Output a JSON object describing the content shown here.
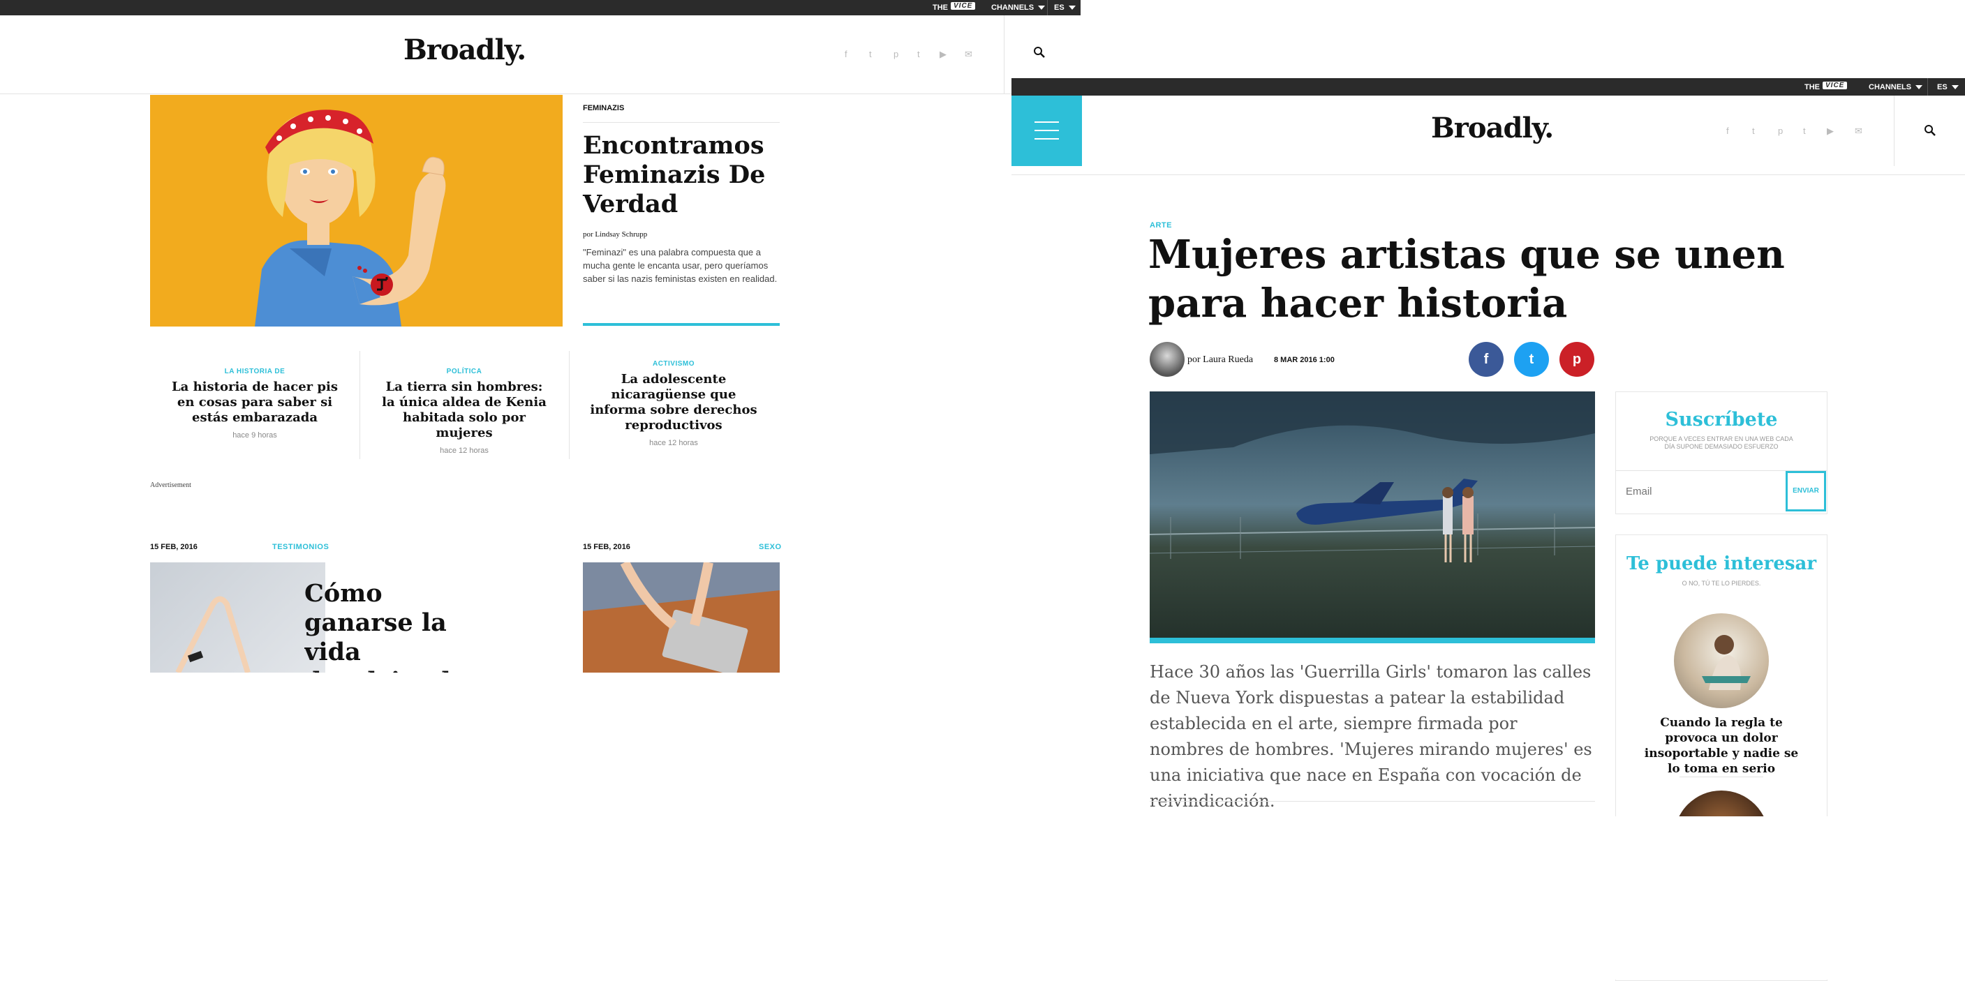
{
  "left": {
    "topbar": {
      "the": "THE",
      "vice": "VICE",
      "channels": "CHANNELS",
      "lang": "ES"
    },
    "brand": "Broadly.",
    "social_icons": [
      "facebook-icon",
      "twitter-icon",
      "pinterest-icon",
      "tumblr-icon",
      "youtube-icon",
      "email-icon"
    ],
    "featured": {
      "category": "FEMINAZIS",
      "title": "Encontramos Feminazis De Verdad",
      "byline": "por Lindsay Schrupp",
      "excerpt": "\"Feminazi\" es una palabra compuesta que a mucha gente le encanta usar, pero queríamos saber si las nazis feministas existen en realidad."
    },
    "cards": [
      {
        "category": "LA HISTORIA DE",
        "title": "La historia de hacer pis en cosas para saber si estás embarazada",
        "time": "hace 9 horas"
      },
      {
        "category": "POLÍTICA",
        "title": "La tierra sin hombres: la única aldea de Kenia habitada solo por mujeres",
        "time": "hace 12 horas"
      },
      {
        "category": "ACTIVISMO",
        "title": "La adolescente nicaragüense que informa sobre derechos reproductivos",
        "time": "hace 12 horas"
      }
    ],
    "ad_label": "Advertisement",
    "bottom": [
      {
        "date": "15 FEB, 2016",
        "category": "TESTIMONIOS",
        "title": "Cómo ganarse la vida devolviendo"
      },
      {
        "date": "15 FEB, 2016",
        "category": "SEXO"
      }
    ]
  },
  "right": {
    "topbar": {
      "the": "THE",
      "vice": "VICE",
      "channels": "CHANNELS",
      "lang": "ES"
    },
    "brand": "Broadly.",
    "article": {
      "category": "ARTE",
      "title": "Mujeres artistas que se unen para hacer historia",
      "author": "por Laura Rueda",
      "date": "8 MAR 2016 1:00",
      "lede": "Hace 30 años las 'Guerrilla Girls' tomaron las calles de Nueva York dispuestas a patear la estabilidad establecida en el arte, siempre firmada por nombres de hombres. 'Mujeres mirando mujeres' es una iniciativa que nace en España con vocación de reivindicación."
    },
    "share": [
      {
        "icon": "facebook-icon",
        "glyph": "f",
        "color": "#3b5998"
      },
      {
        "icon": "twitter-icon",
        "glyph": "t",
        "color": "#1da1f2"
      },
      {
        "icon": "pinterest-icon",
        "glyph": "p",
        "color": "#cb2027"
      }
    ],
    "subscribe": {
      "title": "Suscríbete",
      "subtitle": "PORQUE A VECES ENTRAR EN UNA WEB CADA DÍA SUPONE DEMASIADO ESFUERZO",
      "email_placeholder": "Email",
      "button": "ENVIAR"
    },
    "interest": {
      "title": "Te puede interesar",
      "subtitle": "O NO, TÚ TE LO PIERDES.",
      "item_title": "Cuando la regla te provoca un dolor insoportable y nadie se lo toma en serio"
    }
  }
}
